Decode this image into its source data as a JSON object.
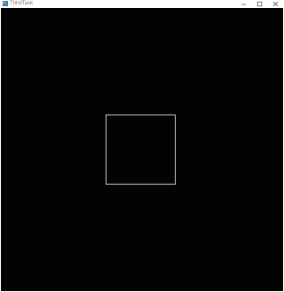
{
  "window": {
    "title": "ThirdTask",
    "controls": {
      "minimize_icon": "minimize-icon",
      "maximize_icon": "maximize-icon",
      "close_icon": "close-icon"
    }
  },
  "canvas": {
    "background": "#030303",
    "shape": {
      "type": "square-outline",
      "stroke": "#c8c8c8"
    }
  }
}
